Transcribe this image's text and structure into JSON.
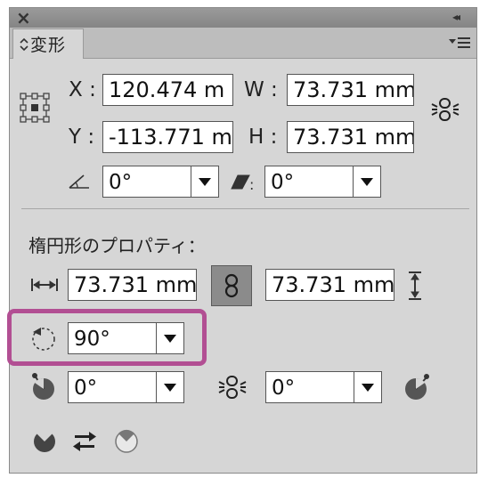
{
  "panel": {
    "close_glyph": "×",
    "collapse_glyph": "◂◂",
    "tab_label": "変形",
    "menu_icon": "panel-menu-icon"
  },
  "transform": {
    "x_label": "X :",
    "x_value": "120.474 m",
    "y_label": "Y :",
    "y_value": "-113.771 m",
    "w_label": "W :",
    "w_value": "73.731 mm",
    "h_label": "H :",
    "h_value": "73.731 mm",
    "angle_value": "0°",
    "shear_value": "0°"
  },
  "ellipse": {
    "section_title": "楕円形のプロパティ：",
    "width_value": "73.731 mm",
    "height_value": "73.731 mm",
    "rotation_value": "90°",
    "pie_start_value": "0°",
    "pie_end_value": "0°"
  },
  "colors": {
    "highlight": "#b24f93",
    "panel_bg": "#d6d6d6"
  }
}
